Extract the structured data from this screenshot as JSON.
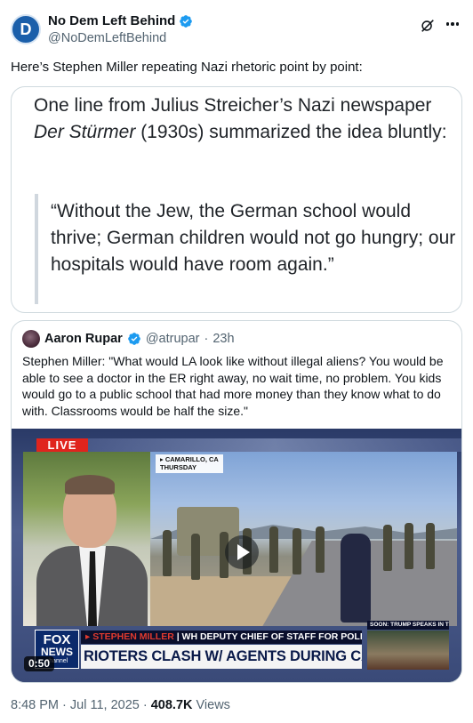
{
  "author": {
    "display_name": "No Dem Left Behind",
    "handle": "@NoDemLeftBehind",
    "avatar_letter": "D"
  },
  "tweet_text": "Here’s Stephen Miller repeating Nazi rhetoric point by point:",
  "quote_image": {
    "lead_before": "One line from Julius Streicher’s Nazi newspaper ",
    "lead_italic": "Der Stürmer",
    "lead_after": " (1930s) summarized the idea bluntly:",
    "body": "“Without the Jew, the German school would thrive; German children would not go hungry; our hospitals would have room again.”"
  },
  "quoted_tweet": {
    "display_name": "Aaron Rupar",
    "handle": "@atrupar",
    "separator": "·",
    "time": "23h",
    "text": "Stephen Miller: \"What would LA look like without illegal aliens? You would be able to see a doctor in the ER right away, no wait time, no problem. You kids would go to a public school that had more money than they know what to do with. Classrooms would be half the size.\""
  },
  "video": {
    "live_label": "LIVE",
    "location_line1": "▸ CAMARILLO, CA",
    "location_line2": "THURSDAY",
    "fox_line1": "FOX",
    "fox_line2": "NEWS",
    "fox_line3": "channel",
    "chyron_name": "▸ STEPHEN MILLER",
    "chyron_title": " | WH DEPUTY CHIEF OF STAFF FOR POLICY",
    "chyron_headline": "RIOTERS CLASH W/ AGENTS DURING CA IMMIGRATION RAID",
    "soon_label": "SOON: TRUMP SPEAKS IN TX",
    "duration": "0:50"
  },
  "meta": {
    "time": "8:48 PM",
    "sep1": " · ",
    "date": "Jul 11, 2025",
    "sep2": " · ",
    "views_count": "408.7K",
    "views_label": " Views"
  },
  "colors": {
    "verified_blue": "#1d9bf0",
    "muted_text": "#536471",
    "border": "#cfd9de",
    "fox_red": "#e0241d"
  },
  "icons": [
    "verified-badge-icon",
    "grok-icon",
    "more-options-icon",
    "play-icon"
  ]
}
